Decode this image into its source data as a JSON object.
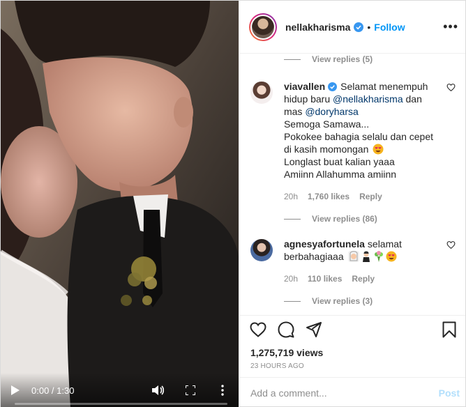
{
  "post": {
    "username": "nellakharisma",
    "follow_label": "Follow",
    "more_label": "•••",
    "views": "1,275,719 views",
    "time_ago": "23 HOURS AGO"
  },
  "video": {
    "time": "0:00 / 1:30",
    "progress": 0.0
  },
  "comments": {
    "replies_top": "View replies (5)",
    "c1": {
      "user": "viavallen",
      "text_1": "Selamat menempuh hidup baru ",
      "mention_1": "@nellakharisma",
      "text_2": " dan mas ",
      "mention_2": "@doryharsa",
      "line_3": "Semoga Samawa...",
      "line_4": "Pokokee bahagia selalu dan cepet di kasih momongan",
      "line_5": "Longlast buat kalian yaaa",
      "line_6": "Amiinn Allahumma amiinn",
      "time": "20h",
      "likes": "1,760 likes",
      "reply": "Reply",
      "view_replies": "View replies (86)"
    },
    "c2": {
      "user": "agnesyafortunela",
      "text": "selamat berbahagiaaa",
      "time": "20h",
      "likes": "110 likes",
      "reply": "Reply",
      "view_replies": "View replies (3)"
    }
  },
  "add_comment": {
    "placeholder": "Add a comment...",
    "post_label": "Post"
  },
  "colors": {
    "accent": "#0095f6",
    "muted": "#8e8e8e"
  }
}
